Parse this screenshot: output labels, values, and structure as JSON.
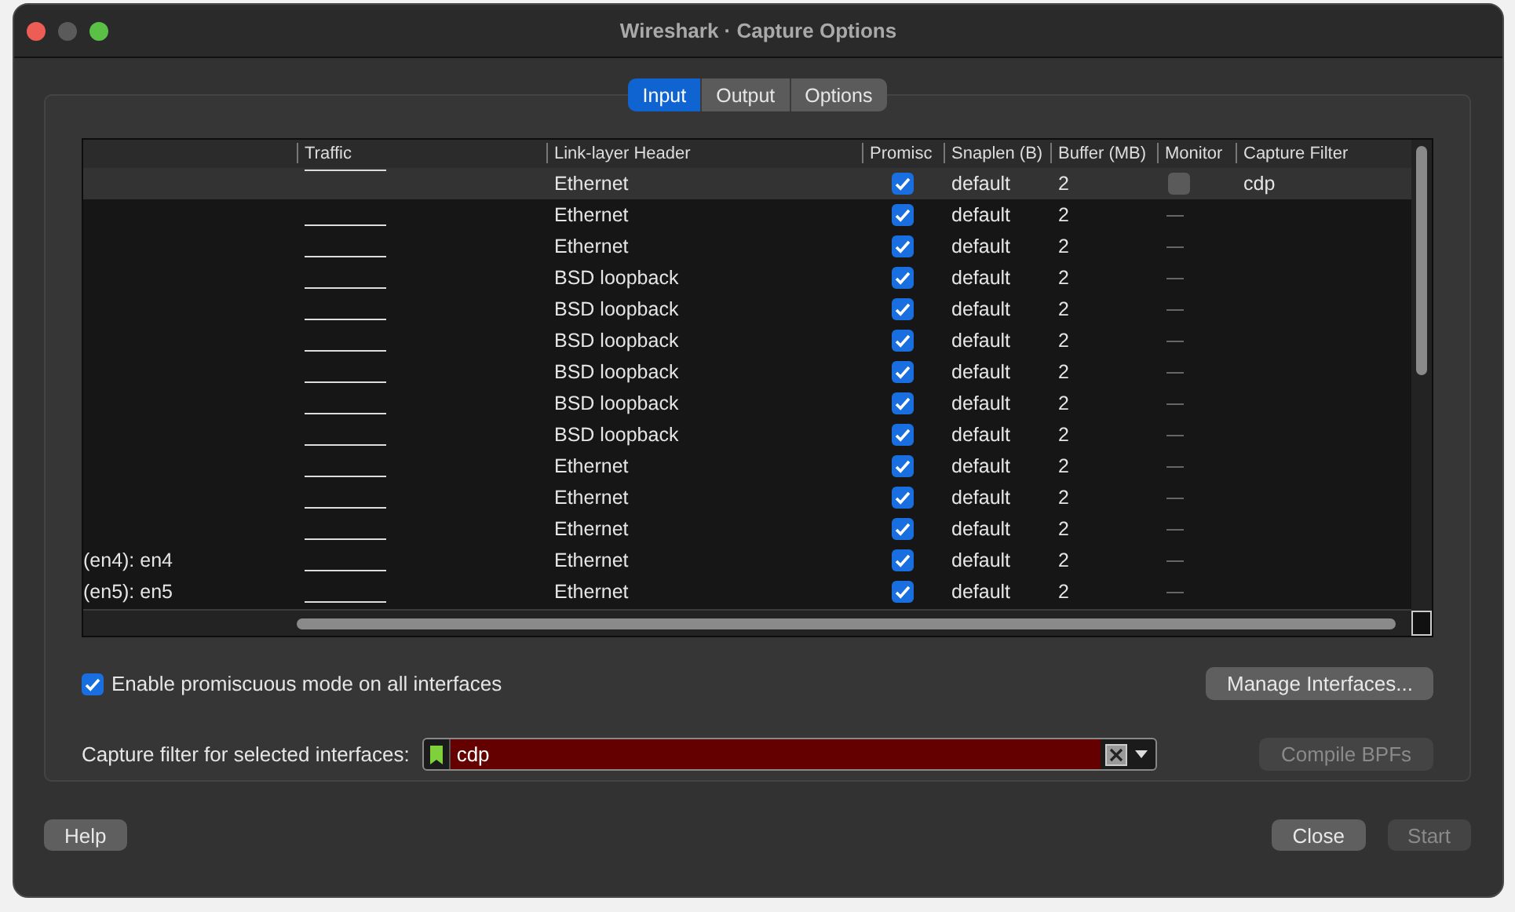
{
  "window": {
    "title": "Wireshark · Capture Options"
  },
  "tabs": [
    {
      "label": "Input",
      "selected": true
    },
    {
      "label": "Output",
      "selected": false
    },
    {
      "label": "Options",
      "selected": false
    }
  ],
  "table": {
    "columns": [
      "",
      "Traffic",
      "Link-layer Header",
      "Promisc",
      "Snaplen (B)",
      "Buffer (MB)",
      "Monitor",
      "Capture Filter"
    ],
    "rows": [
      {
        "name": "",
        "link_header": "Ethernet",
        "promiscuous": true,
        "snaplen": "default",
        "buffer": "2",
        "monitor_supported": true,
        "monitor": false,
        "capture_filter": "cdp",
        "selected": true
      },
      {
        "name": "",
        "link_header": "Ethernet",
        "promiscuous": true,
        "snaplen": "default",
        "buffer": "2",
        "monitor_supported": false,
        "selected": false
      },
      {
        "name": "",
        "link_header": "Ethernet",
        "promiscuous": true,
        "snaplen": "default",
        "buffer": "2",
        "monitor_supported": false,
        "selected": false
      },
      {
        "name": "",
        "link_header": "BSD loopback",
        "promiscuous": true,
        "snaplen": "default",
        "buffer": "2",
        "monitor_supported": false,
        "selected": false
      },
      {
        "name": "",
        "link_header": "BSD loopback",
        "promiscuous": true,
        "snaplen": "default",
        "buffer": "2",
        "monitor_supported": false,
        "selected": false
      },
      {
        "name": "",
        "link_header": "BSD loopback",
        "promiscuous": true,
        "snaplen": "default",
        "buffer": "2",
        "monitor_supported": false,
        "selected": false
      },
      {
        "name": "",
        "link_header": "BSD loopback",
        "promiscuous": true,
        "snaplen": "default",
        "buffer": "2",
        "monitor_supported": false,
        "selected": false
      },
      {
        "name": "",
        "link_header": "BSD loopback",
        "promiscuous": true,
        "snaplen": "default",
        "buffer": "2",
        "monitor_supported": false,
        "selected": false
      },
      {
        "name": "",
        "link_header": "BSD loopback",
        "promiscuous": true,
        "snaplen": "default",
        "buffer": "2",
        "monitor_supported": false,
        "selected": false
      },
      {
        "name": "",
        "link_header": "Ethernet",
        "promiscuous": true,
        "snaplen": "default",
        "buffer": "2",
        "monitor_supported": false,
        "selected": false
      },
      {
        "name": "",
        "link_header": "Ethernet",
        "promiscuous": true,
        "snaplen": "default",
        "buffer": "2",
        "monitor_supported": false,
        "selected": false
      },
      {
        "name": "",
        "link_header": "Ethernet",
        "promiscuous": true,
        "snaplen": "default",
        "buffer": "2",
        "monitor_supported": false,
        "selected": false
      },
      {
        "name": "(en4): en4",
        "link_header": "Ethernet",
        "promiscuous": true,
        "snaplen": "default",
        "buffer": "2",
        "monitor_supported": false,
        "selected": false
      },
      {
        "name": "(en5): en5",
        "link_header": "Ethernet",
        "promiscuous": true,
        "snaplen": "default",
        "buffer": "2",
        "monitor_supported": false,
        "selected": false
      }
    ]
  },
  "promiscuous_all": {
    "label": "Enable promiscuous mode on all interfaces",
    "checked": true
  },
  "manage_button": "Manage Interfaces...",
  "filter": {
    "label": "Capture filter for selected interfaces:",
    "value": "cdp",
    "valid": false
  },
  "compile_button": {
    "label": "Compile BPFs",
    "disabled": true
  },
  "buttons": [
    {
      "label": "Help",
      "disabled": false
    },
    {
      "label": "Close",
      "disabled": false
    },
    {
      "label": "Start",
      "disabled": true
    }
  ]
}
